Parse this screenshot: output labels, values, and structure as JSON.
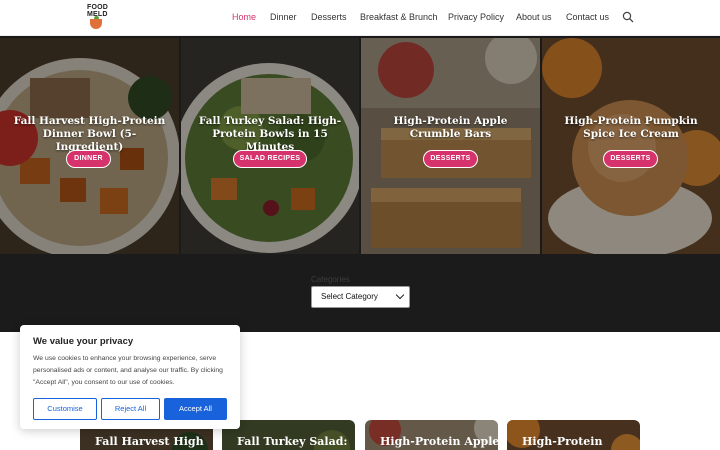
{
  "logo": {
    "line1": "FOOD",
    "line2": "MELD"
  },
  "nav": {
    "items": [
      {
        "label": "Home",
        "active": true
      },
      {
        "label": "Dinner"
      },
      {
        "label": "Desserts"
      },
      {
        "label": "Breakfast & Brunch"
      },
      {
        "label": "Privacy Policy"
      },
      {
        "label": "About us"
      },
      {
        "label": "Contact us"
      }
    ],
    "search_icon": "search-icon"
  },
  "hero": {
    "cards": [
      {
        "title": "Fall Harvest High-Protein Dinner Bowl (5-Ingredient)",
        "category": "DINNER"
      },
      {
        "title": "Fall Turkey Salad: High-Protein Bowls in 15 Minutes",
        "category": "SALAD RECIPES"
      },
      {
        "title": "High-Protein Apple Crumble Bars",
        "category": "DESSERTS"
      },
      {
        "title": "High-Protein Pumpkin Spice Ice Cream",
        "category": "DESSERTS"
      }
    ]
  },
  "categories": {
    "label": "Categories",
    "selected": "Select Category"
  },
  "bottom_cards": [
    {
      "title": "Fall Harvest High"
    },
    {
      "title": "Fall Turkey Salad:"
    },
    {
      "title": "High-Protein Apple"
    },
    {
      "title": "High-Protein"
    }
  ],
  "cookie": {
    "title": "We value your privacy",
    "text": "We use cookies to enhance your browsing experience, serve personalised ads or content, and analyse our traffic. By clicking \"Accept All\", you consent to our use of cookies.",
    "customise": "Customise",
    "reject": "Reject All",
    "accept": "Accept All"
  },
  "colors": {
    "accent": "#d6336c",
    "cookie_blue": "#1863dc",
    "band": "#1b1b1b"
  }
}
